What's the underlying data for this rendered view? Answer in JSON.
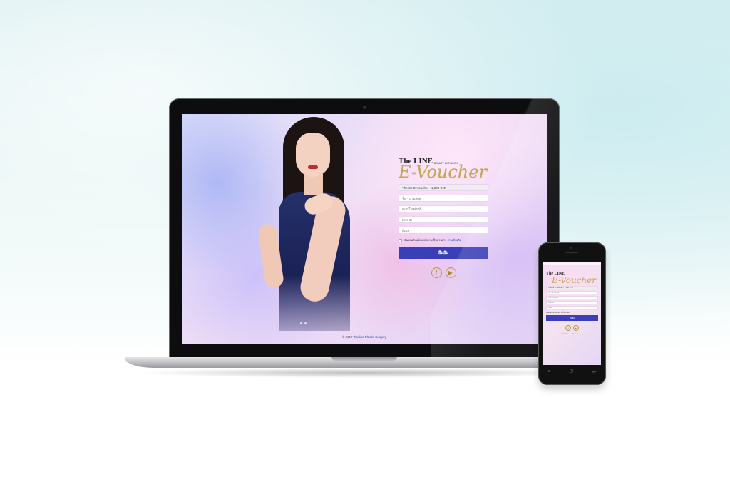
{
  "brand": {
    "the_line": "The LINE",
    "sub": "BEAUTY ANTIAGING",
    "script": "E-Voucher"
  },
  "form": {
    "voucher_select": "Theline E-Voucher - 1,000 บาท",
    "name_placeholder": "ชื่อ - นามสกุล",
    "phone_placeholder": "เบอร์โทรศัพท์",
    "line_placeholder": "Line ID",
    "email_placeholder": "อีเมล",
    "consent_text": "ฉันยอมรับนโยบายความเป็นส่วนตัว",
    "consent_link": "อ่านเพิ่มเติม",
    "submit_label": "ยืนยัน"
  },
  "social": {
    "facebook": "f",
    "youtube": "▶"
  },
  "footer": {
    "copyright": "© 2017",
    "company": "Theline Plastic Surgery"
  },
  "phone_buttons": [
    "≡",
    "⏻",
    "↩"
  ],
  "colors": {
    "accent_blue": "#3a3fb8",
    "gold": "#c9a652",
    "link_blue": "#2c46c7"
  },
  "icons": {
    "facebook": "facebook-icon",
    "youtube": "youtube-icon"
  }
}
